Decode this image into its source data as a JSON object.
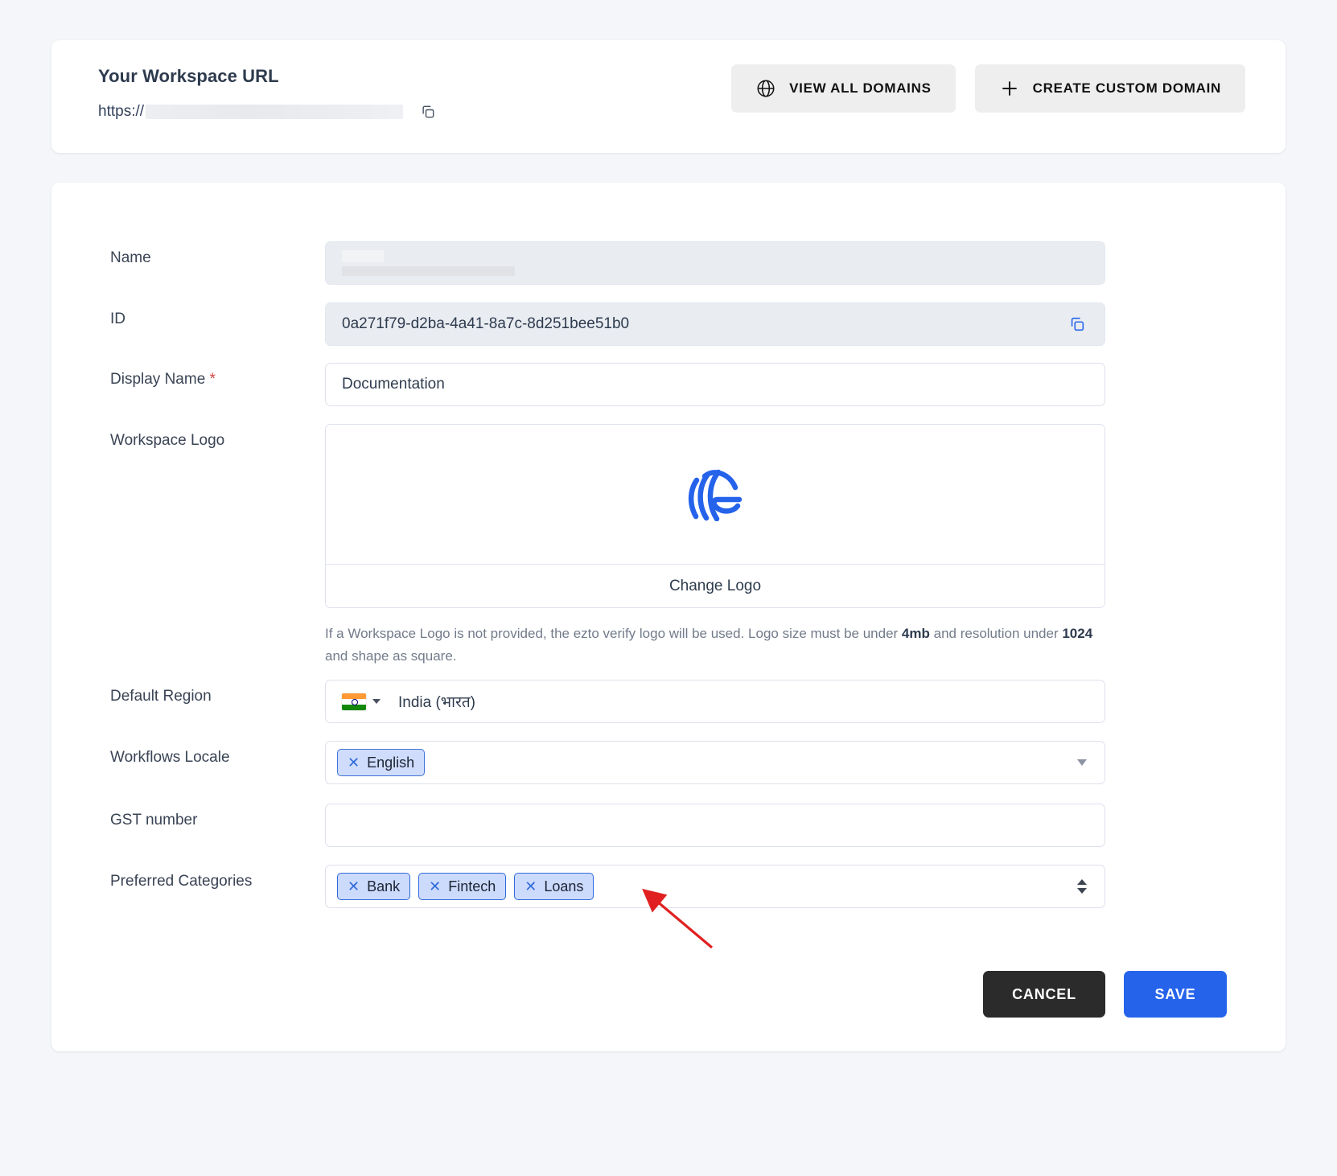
{
  "url_card": {
    "title": "Your Workspace URL",
    "protocol": "https://",
    "value_redacted": true,
    "copy_icon": "copy-icon",
    "buttons": [
      {
        "label": "VIEW ALL DOMAINS",
        "icon": "globe-icon"
      },
      {
        "label": "CREATE CUSTOM DOMAIN",
        "icon": "plus-icon"
      }
    ]
  },
  "form": {
    "name": {
      "label": "Name",
      "value": "",
      "redacted": true,
      "disabled": true
    },
    "id": {
      "label": "ID",
      "value": "0a271f79-d2ba-4a41-8a7c-8d251bee51b0",
      "disabled": true,
      "copy_icon": "copy-icon"
    },
    "display_name": {
      "label": "Display Name",
      "required_marker": "*",
      "value": "Documentation",
      "placeholder": "Display Name"
    },
    "workspace_logo": {
      "label": "Workspace Logo",
      "change_label": "Change Logo",
      "logo_icon": "fingerprint-logo-icon",
      "hint_part1": "If a Workspace Logo is not provided, the ezto verify logo will be used. Logo size must be under ",
      "hint_bold1": "4mb",
      "hint_part2": " and resolution under ",
      "hint_bold2": "1024",
      "hint_part3": " and shape as square."
    },
    "default_region": {
      "label": "Default Region",
      "value": "India (भारत)",
      "flag": "india-flag-icon"
    },
    "workflows_locale": {
      "label": "Workflows Locale",
      "chips": [
        "English"
      ]
    },
    "gst_number": {
      "label": "GST number",
      "value": "",
      "placeholder": ""
    },
    "preferred_categories": {
      "label": "Preferred Categories",
      "chips": [
        "Bank",
        "Fintech",
        "Loans"
      ]
    }
  },
  "actions": {
    "cancel": "CANCEL",
    "save": "SAVE"
  },
  "colors": {
    "accent_blue": "#2563eb",
    "chip_bg": "#ccdafc",
    "chip_border": "#2f6bdb",
    "cancel_bg": "#2b2b2b",
    "page_bg": "#f4f6f9",
    "annotation_red": "#e02020"
  },
  "annotation": {
    "arrow": "red-arrow-pointer",
    "points_to": "preferred-categories-field"
  }
}
